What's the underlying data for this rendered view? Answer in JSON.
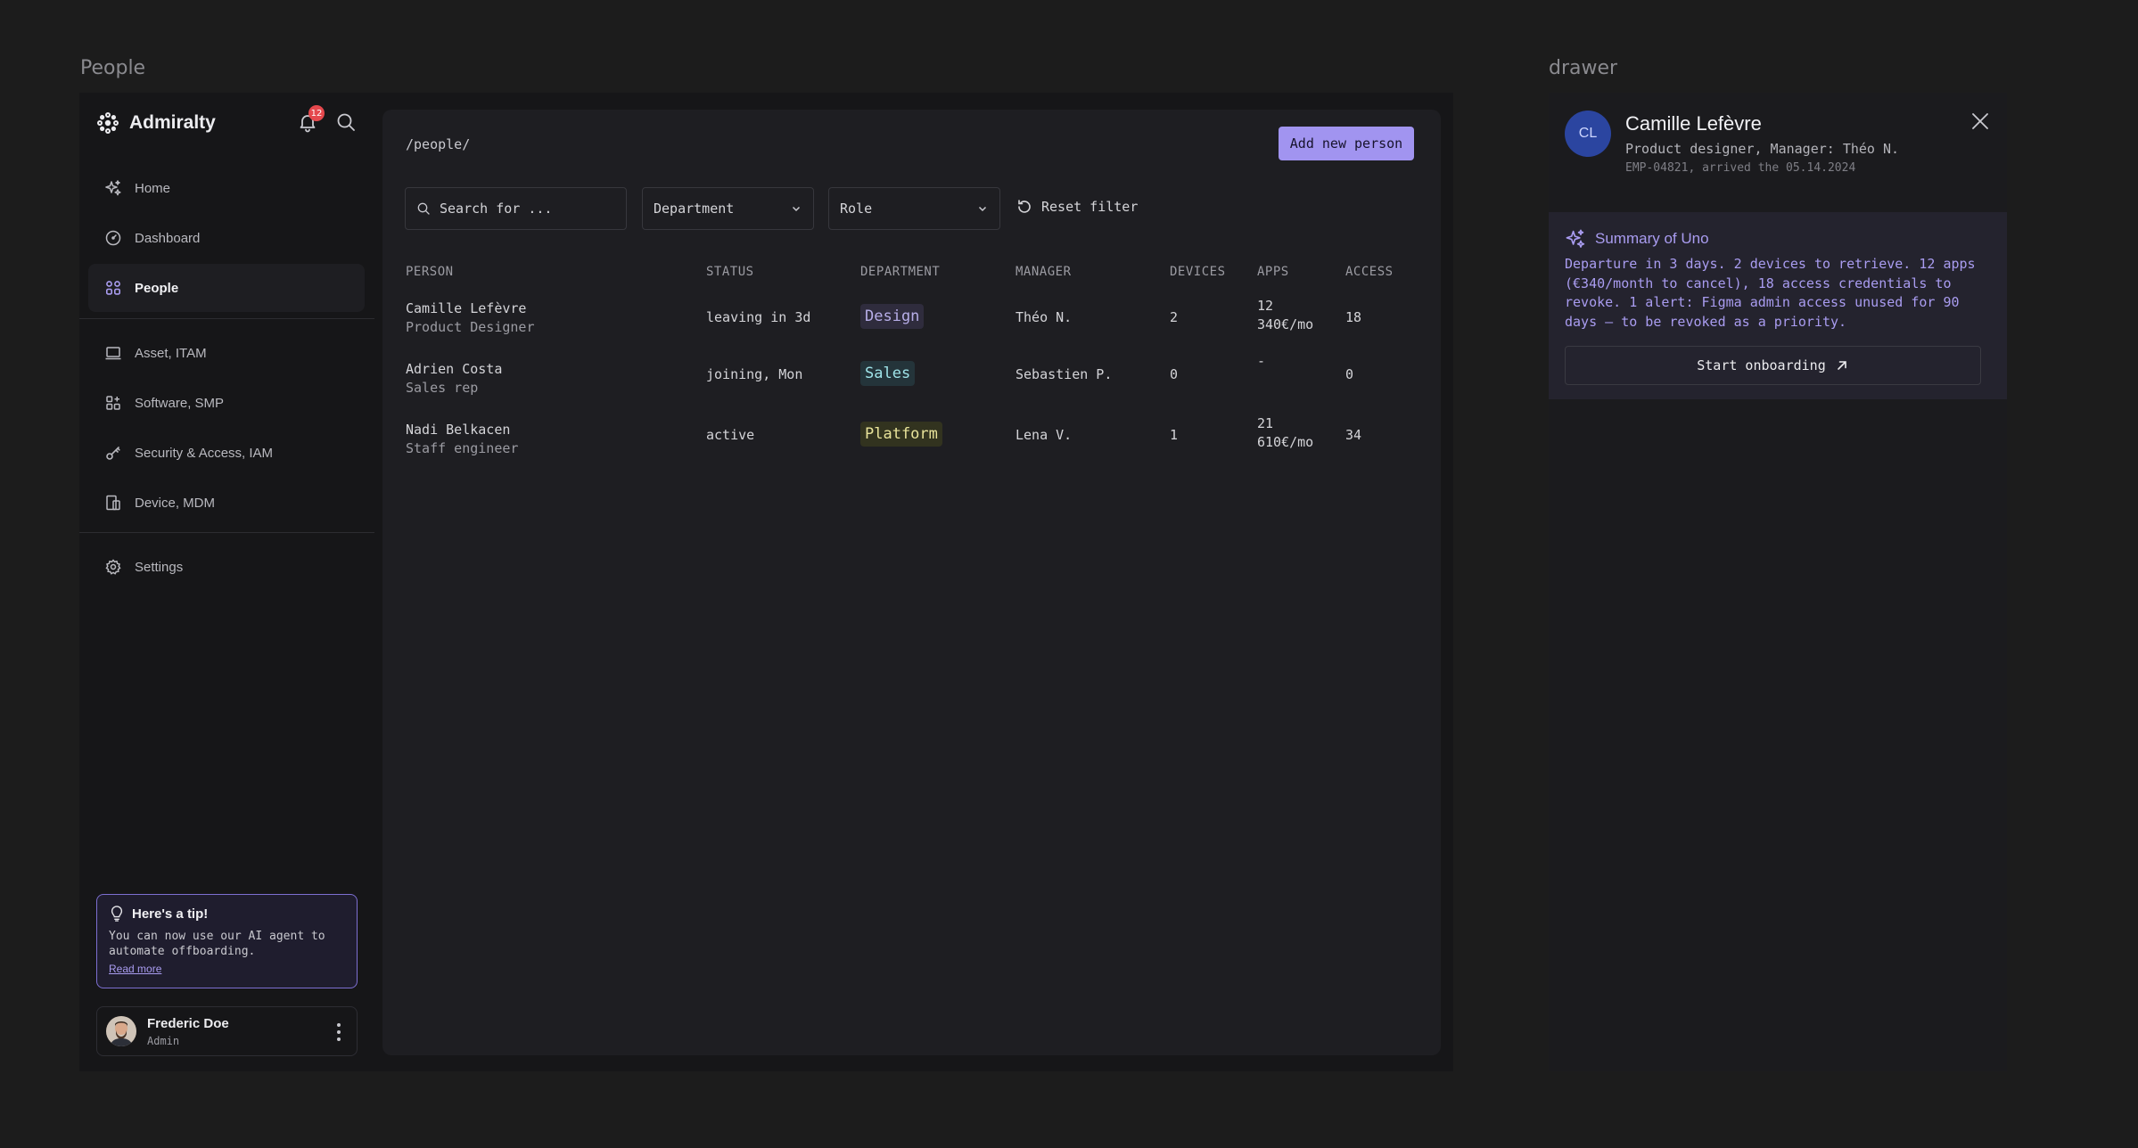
{
  "frames": {
    "people_label": "People",
    "drawer_label": "drawer"
  },
  "brand": {
    "name": "Admiralty"
  },
  "notifications": {
    "count": "12"
  },
  "sidebar": {
    "items": [
      {
        "label": "Home",
        "icon": "sparkle-icon"
      },
      {
        "label": "Dashboard",
        "icon": "gauge-icon"
      },
      {
        "label": "People",
        "icon": "people-grid-icon",
        "active": true
      },
      {
        "label": "Asset, ITAM",
        "icon": "laptop-icon"
      },
      {
        "label": "Software, SMP",
        "icon": "apps-icon"
      },
      {
        "label": "Security & Access, IAM",
        "icon": "key-icon"
      },
      {
        "label": "Device, MDM",
        "icon": "device-icon"
      },
      {
        "label": "Settings",
        "icon": "gear-icon"
      }
    ]
  },
  "tip": {
    "title": "Here's a tip!",
    "body": "You can now use our AI agent to automate offboarding.",
    "link": "Read more"
  },
  "user": {
    "name": "Frederic Doe",
    "role": "Admin"
  },
  "main": {
    "breadcrumb": "/people/",
    "add_button": "Add new person",
    "search_placeholder": "Search for ...",
    "filter_department": "Department",
    "filter_role": "Role",
    "reset_filter": "Reset filter",
    "columns": [
      "PERSON",
      "STATUS",
      "DEPARTMENT",
      "MANAGER",
      "DEVICES",
      "APPS",
      "ACCESS"
    ],
    "rows": [
      {
        "name": "Camille Lefèvre",
        "title": "Product Designer",
        "status": "leaving in 3d",
        "department": "Design",
        "manager": "Théo N.",
        "devices": "2",
        "apps": "12",
        "apps_cost": "340€/mo",
        "access": "18"
      },
      {
        "name": "Adrien Costa",
        "title": "Sales rep",
        "status": "joining, Mon",
        "department": "Sales",
        "manager": "Sebastien P.",
        "devices": "0",
        "apps": "-",
        "apps_cost": "",
        "access": "0"
      },
      {
        "name": "Nadi Belkacen",
        "title": "Staff engineer",
        "status": "active",
        "department": "Platform",
        "manager": "Lena V.",
        "devices": "1",
        "apps": "21",
        "apps_cost": "610€/mo",
        "access": "34"
      }
    ]
  },
  "dept_colors": {
    "Design": {
      "bg": "#2f2c3d",
      "fg": "#b7aee8"
    },
    "Sales": {
      "bg": "#24343a",
      "fg": "#9fe3e8"
    },
    "Platform": {
      "bg": "#32331f",
      "fg": "#e8e39a"
    }
  },
  "drawer": {
    "initials": "CL",
    "name": "Camille Lefèvre",
    "role": "Product designer, Manager: Théo N.",
    "meta": "EMP-04821, arrived the 05.14.2024",
    "summary_title": "Summary of Uno",
    "summary_text": "Departure in 3 days. 2 devices to retrieve. 12 apps (€340/month to cancel), 18 access credentials to revoke. 1 alert: Figma admin access unused for 90 days — to be revoked as a priority.",
    "start_button": "Start onboarding"
  },
  "colors": {
    "accent": "#a194f0",
    "badge": "#e5484d"
  }
}
